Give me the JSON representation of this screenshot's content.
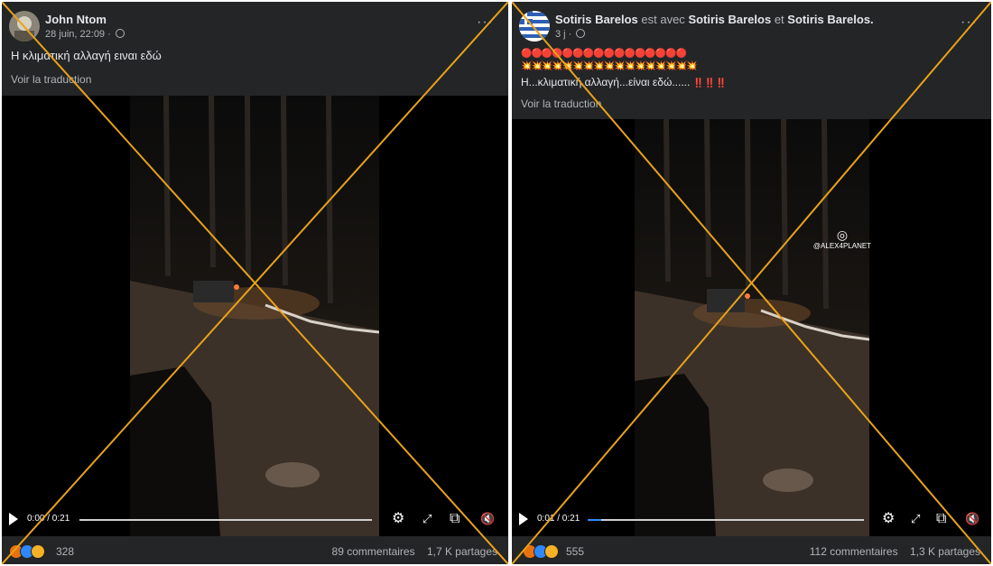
{
  "posts": [
    {
      "author": "John Ntom",
      "time": "28 juin, 22:09 ·",
      "caption": "Η κλιματική αλλαγή ειναι εδώ",
      "translate": "Voir la traduction",
      "video": {
        "time": "0:00 / 0:21",
        "progress": 0.0
      },
      "reaction_count": "328",
      "comments": "89 commentaires",
      "shares": "1,7 K partages"
    },
    {
      "author": "Sotiris Barelos",
      "with_text": "est avec",
      "with_1": "Sotiris Barelos",
      "and_text": "et",
      "with_2": "Sotiris Barelos.",
      "time": "3 j ·",
      "emoji_line_1": "🔴🔴🔴🔴🔴🔴🔴🔴🔴🔴🔴🔴🔴🔴🔴🔴",
      "emoji_line_2": "💥💥💥💥💥💥💥💥💥💥💥💥💥💥💥💥💥",
      "caption": "Η...κλιματική αλλαγή...είναι εδώ......",
      "caption_marks": "‼️‼️‼️",
      "translate": "Voir la traduction",
      "watermark": "@ALEX4PLANET",
      "video": {
        "time": "0:01 / 0:21",
        "progress": 0.05
      },
      "reaction_count": "555",
      "comments": "112 commentaires",
      "shares": "1,3 K partages"
    }
  ],
  "colors": {
    "panel_bg": "#242526",
    "cross": "#e8a21a",
    "like": "#2d88ff",
    "angry": "#e9710f",
    "wow": "#f7b125"
  },
  "icons": [
    "more-options-icon",
    "globe-icon",
    "play-icon",
    "settings-gear-icon",
    "fullscreen-icon",
    "pip-icon",
    "mute-icon",
    "instagram-icon"
  ]
}
